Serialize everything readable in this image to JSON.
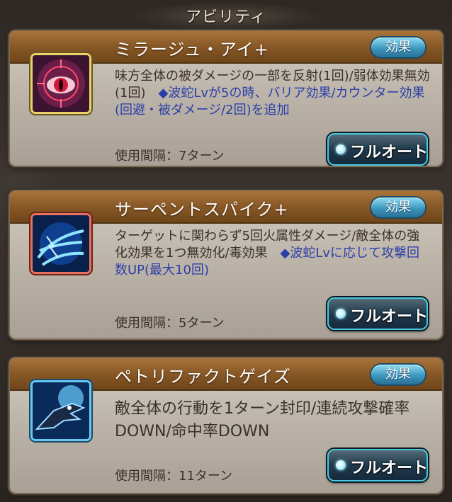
{
  "header": {
    "title": "アビリティ"
  },
  "abilities": [
    {
      "name": "ミラージュ・アイ+",
      "effect_label": "効果",
      "desc": "味方全体の被ダメージの一部を反射(1回)/弱体効果無効(1回)　",
      "desc_highlight": "◆波蛇Lvが5の時、バリア効果/カウンター効果(回避・被ダメージ/2回)を追加",
      "interval": "使用間隔：7ターン",
      "auto_label": "フルオート",
      "icon": "red-eye-icon"
    },
    {
      "name": "サーペントスパイク+",
      "effect_label": "効果",
      "desc": "ターゲットに関わらず5回火属性ダメージ/敵全体の強化効果を1つ無効化/毒効果　",
      "desc_highlight": "◆波蛇Lvに応じて攻撃回数UP(最大10回)",
      "interval": "使用間隔：5ターン",
      "auto_label": "フルオート",
      "icon": "serpent-spike-icon"
    },
    {
      "name": "ペトリファクトゲイズ",
      "effect_label": "効果",
      "desc": "敵全体の行動を1ターン封印/連続攻撃確率DOWN/命中率DOWN",
      "desc_highlight": "",
      "interval": "使用間隔：11ターン",
      "auto_label": "フルオート",
      "icon": "dragon-head-icon"
    }
  ]
}
